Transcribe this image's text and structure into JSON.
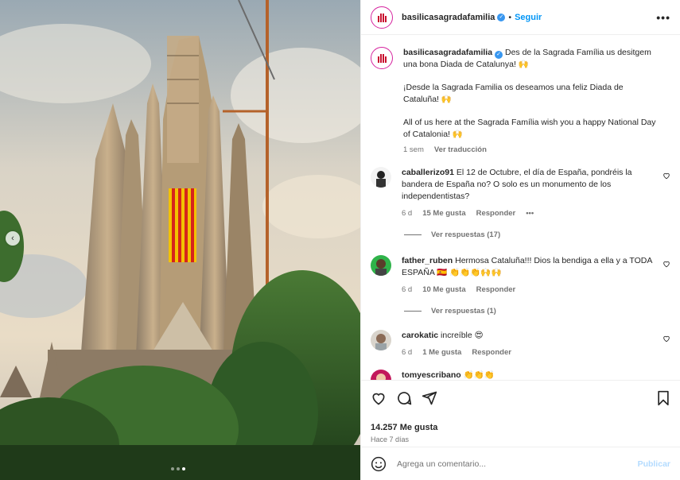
{
  "post": {
    "username": "basilicasagradafamilia",
    "follow_label": "Seguir",
    "more_label": "•••",
    "separator": "•",
    "carousel_prev": "‹"
  },
  "caption": {
    "username": "basilicasagradafamilia",
    "paragraph_ca": "Des de la Sagrada Família us desitgem una bona Diada de Catalunya! 🙌",
    "paragraph_es": "¡Desde la Sagrada Familia os deseamos una feliz Diada de Cataluña! 🙌",
    "paragraph_en": "All of us here at the Sagrada Família wish you a happy National Day of Catalonia! 🙌",
    "time": "1 sem",
    "translate_label": "Ver traducción"
  },
  "comments": [
    {
      "username": "caballerizo91",
      "text": "El 12 de Octubre, el día de España, pondréis la bandera de España no? O solo es un monumento de los independentistas?",
      "time": "6 d",
      "likes": "15 Me gusta",
      "reply_label": "Responder",
      "options_label": "•••",
      "view_replies": "Ver respuestas (17)"
    },
    {
      "username": "father_ruben",
      "text": "Hermosa Cataluña!!! Dios la bendiga a ella y a TODA ESPAÑA 🇪🇸 👏👏👏🙌🙌",
      "time": "6 d",
      "likes": "10 Me gusta",
      "reply_label": "Responder",
      "view_replies": "Ver respuestas (1)"
    },
    {
      "username": "carokatic",
      "text": "increíble 😍",
      "time": "6 d",
      "likes": "1 Me gusta",
      "reply_label": "Responder"
    },
    {
      "username": "tomyescribano",
      "text": "👏👏👏"
    }
  ],
  "stats": {
    "likes": "14.257 Me gusta",
    "posted": "Hace 7 días"
  },
  "composer": {
    "placeholder": "Agrega un comentario...",
    "publish_label": "Publicar"
  },
  "colors": {
    "link_blue": "#0095f6",
    "muted": "#737373",
    "publish_disabled": "#b3dbff"
  }
}
